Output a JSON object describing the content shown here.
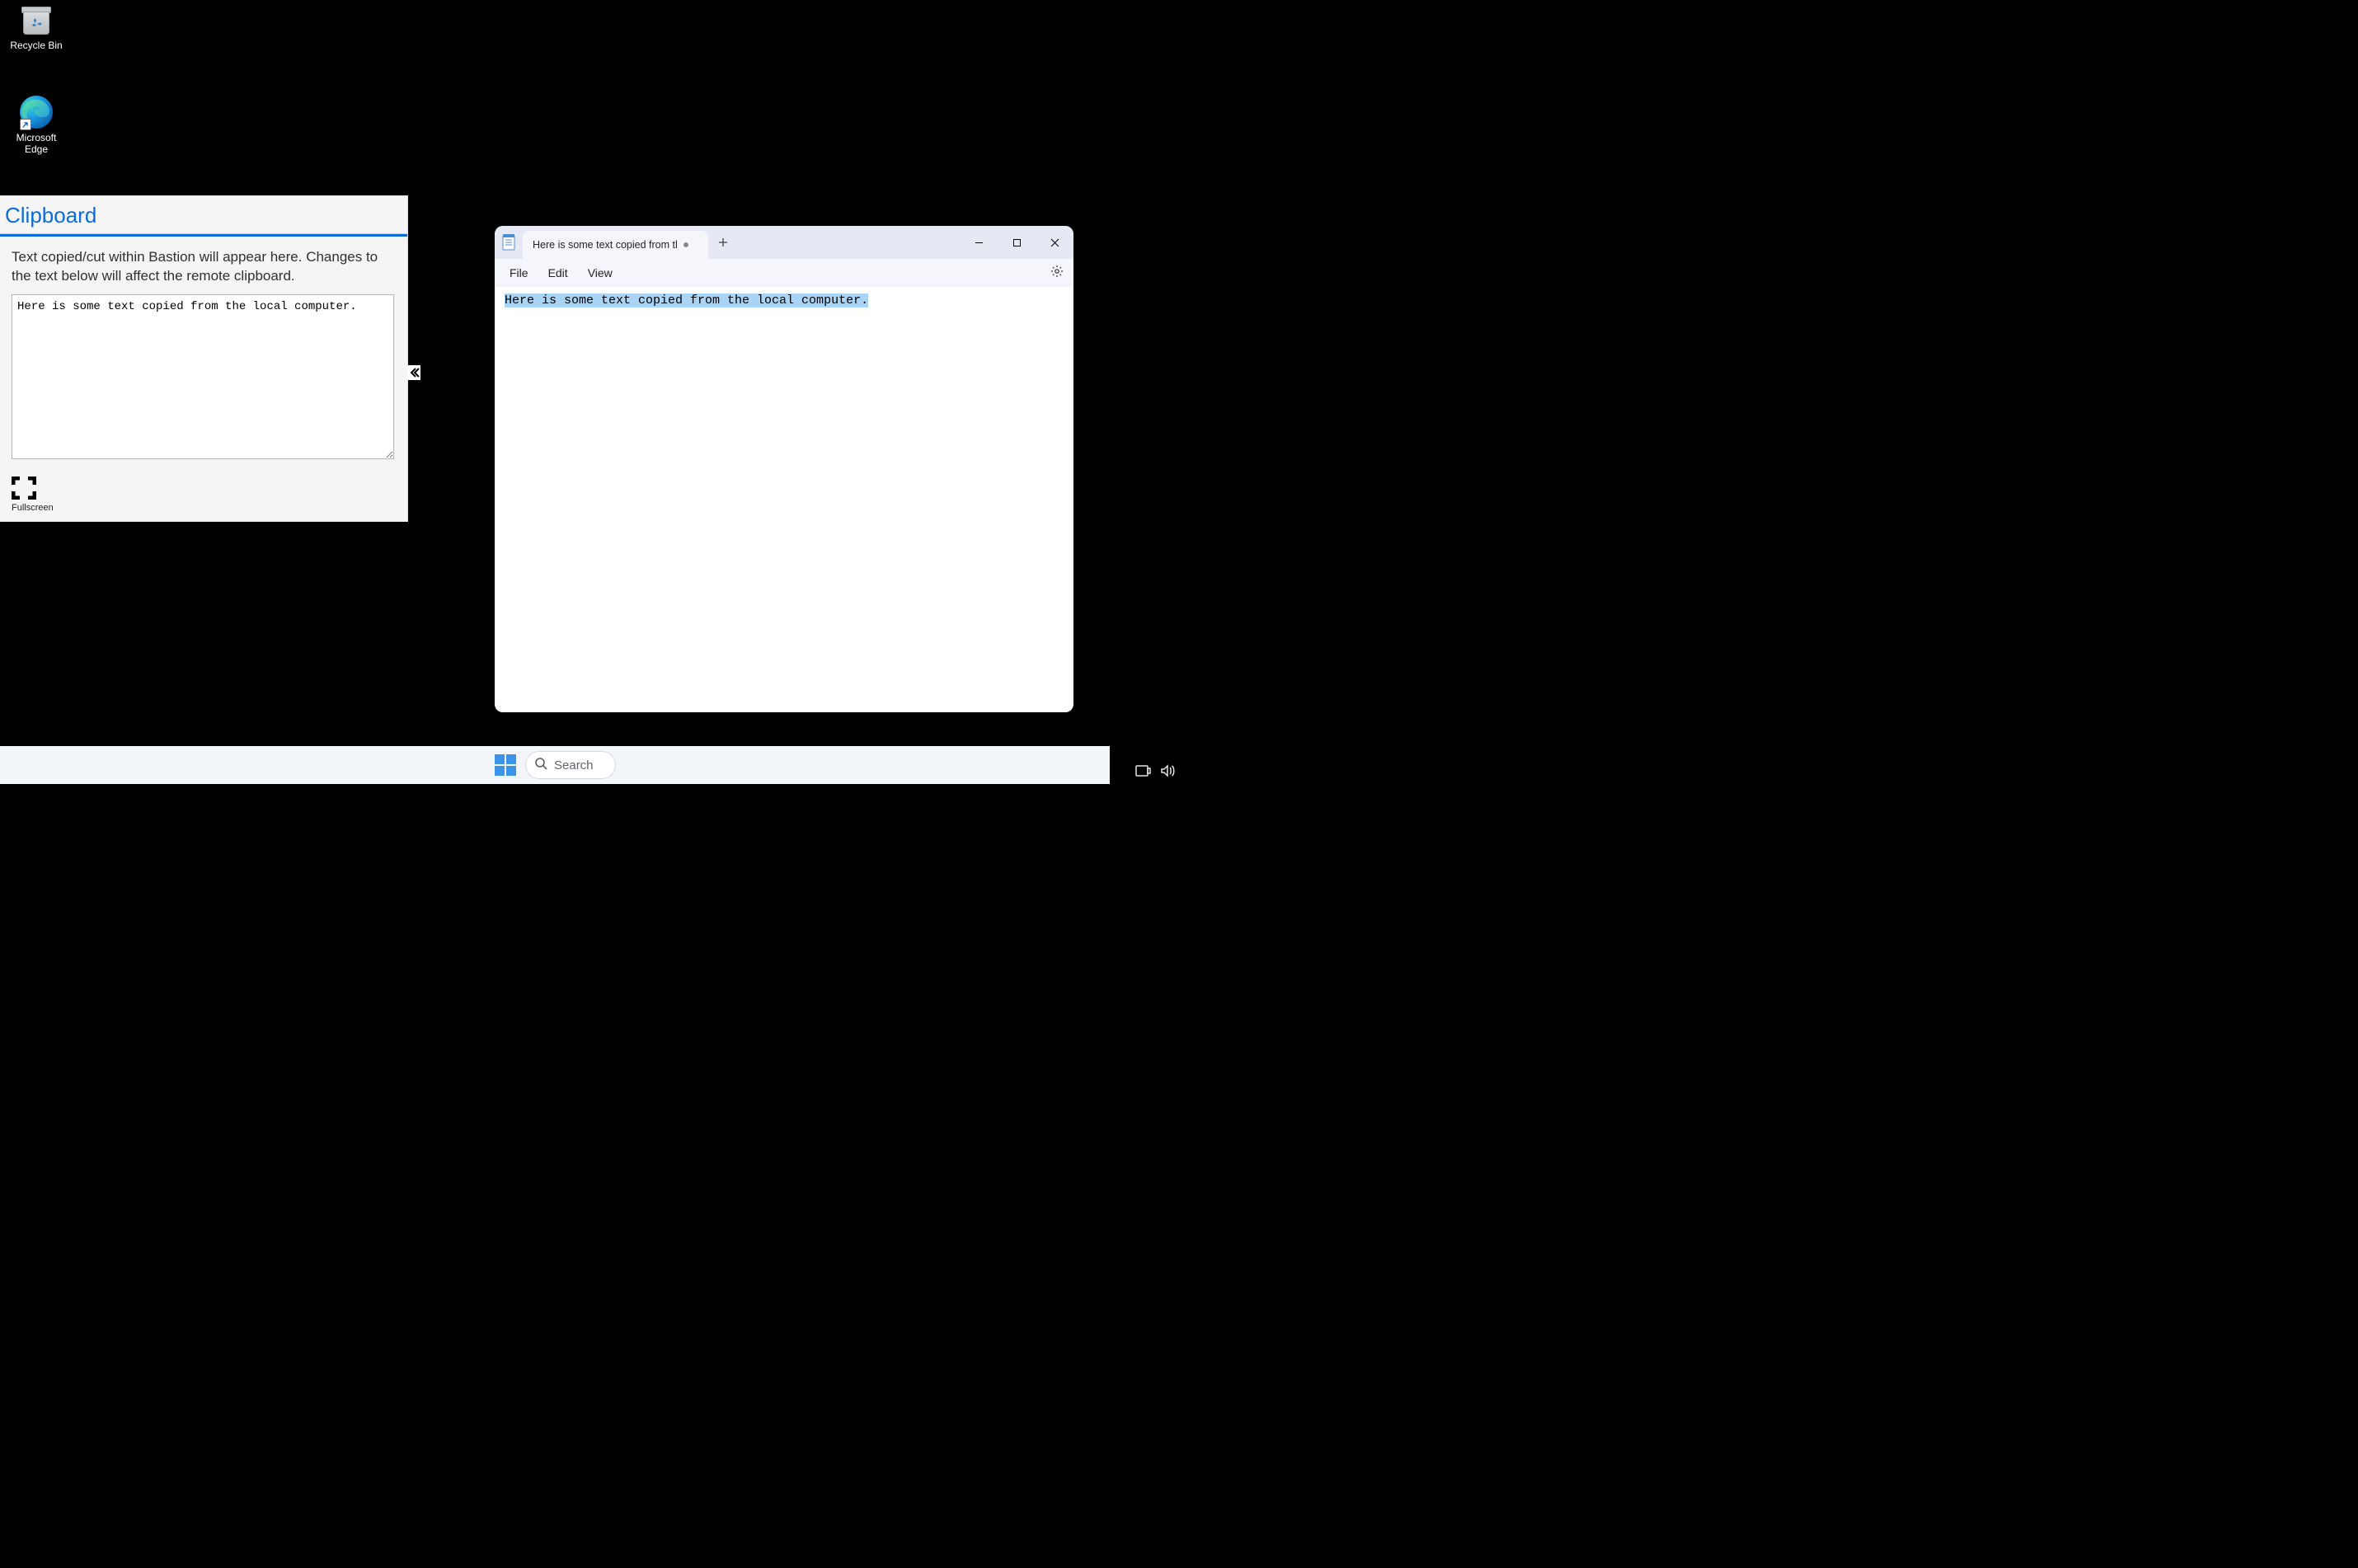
{
  "desktop": {
    "icons": {
      "recycle_bin": "Recycle Bin",
      "edge": "Microsoft\nEdge"
    }
  },
  "clipboard_panel": {
    "title": "Clipboard",
    "description": "Text copied/cut within Bastion will appear here. Changes to the text below will affect the remote clipboard.",
    "textarea_value": "Here is some text copied from the local computer.",
    "fullscreen_label": "Fullscreen"
  },
  "notepad": {
    "tab_title": "Here is some text copied from the l",
    "menus": {
      "file": "File",
      "edit": "Edit",
      "view": "View"
    },
    "body_text": "Here is some text copied from the local computer."
  },
  "taskbar": {
    "search_placeholder": "Search"
  }
}
